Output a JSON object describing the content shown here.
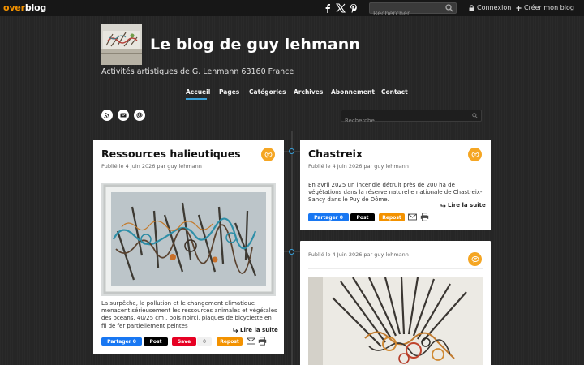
{
  "topbar": {
    "logo_part1": "over",
    "logo_part2": "blog",
    "search_placeholder": "Rechercher",
    "login_label": "Connexion",
    "create_label": "Créer mon blog",
    "social_icons": [
      "facebook-icon",
      "x-icon",
      "pinterest-icon"
    ]
  },
  "header": {
    "title": "Le blog de guy lehmann",
    "description": "Activités artistiques de G. Lehmann 63160 France"
  },
  "nav": {
    "items": [
      "Accueil",
      "Pages",
      "Catégories",
      "Archives",
      "Abonnement",
      "Contact"
    ],
    "active": "Accueil"
  },
  "sidebar": {
    "icons": [
      "rss-icon",
      "email-icon",
      "at-icon"
    ],
    "search_placeholder": "Recherche..."
  },
  "posts": [
    {
      "title": "Ressources halieutiques",
      "meta": "Publié le 4 Juin 2026 par guy lehmann",
      "text": "La surpêche, la pollution et le changement climatique menacent sérieusement les ressources animales et végétales des océans. 40/25 cm . bois noirci, plaques de bicyclette en fil de fer partiellement peintes",
      "readmore": "Lire la suite",
      "share": {
        "facebook": "Partager 0",
        "x": "Post",
        "pinterest": "Save",
        "pin_count": "0",
        "repost": "Repost"
      }
    },
    {
      "title": "Chastreix",
      "meta": "Publié le 4 Juin 2026 par guy lehmann",
      "text": "En avril 2025 un incendie détruit près de 200 ha de végétations dans la réserve naturelle nationale de Chastreix-Sancy dans le Puy de Dôme.",
      "readmore": "Lire la suite",
      "share": {
        "facebook": "Partager 0",
        "x": "Post",
        "repost": "Repost"
      }
    },
    {
      "title": "",
      "meta": "Publié le 4 Juin 2026 par guy lehmann"
    }
  ],
  "colors": {
    "accent_blue": "#3aa0d8",
    "badge_orange": "#f5a623",
    "logo_orange": "#f39200",
    "background": "#262626"
  }
}
